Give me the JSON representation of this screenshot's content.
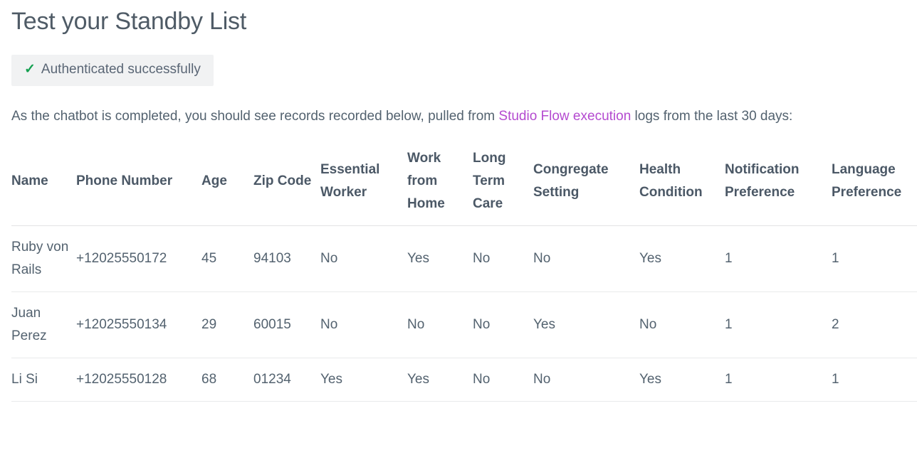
{
  "page": {
    "title": "Test your Standby List"
  },
  "auth_badge": {
    "icon": "check-icon",
    "label": "Authenticated successfully",
    "icon_glyph": "✓",
    "accent_color": "#14a051",
    "background_color": "#f1f2f3"
  },
  "description": {
    "before_link": "As the chatbot is completed, you should see records recorded below, pulled from ",
    "link_text": "Studio Flow execution",
    "after_link": " logs from the last 30 days:",
    "link_color": "#b44ad0"
  },
  "table": {
    "headers": [
      "Name",
      "Phone Number",
      "Age",
      "Zip Code",
      "Essential Worker",
      "Work from Home",
      "Long Term Care",
      "Congregate Setting",
      "Health Condition",
      "Notification Preference",
      "Language Preference"
    ],
    "rows": [
      {
        "name": "Ruby von Rails",
        "phone_number": "+12025550172",
        "age": "45",
        "zip_code": "94103",
        "essential_worker": "No",
        "work_from_home": "Yes",
        "long_term_care": "No",
        "congregate_setting": "No",
        "health_condition": "Yes",
        "notification_preference": "1",
        "language_preference": "1"
      },
      {
        "name": "Juan Perez",
        "phone_number": "+12025550134",
        "age": "29",
        "zip_code": "60015",
        "essential_worker": "No",
        "work_from_home": "No",
        "long_term_care": "No",
        "congregate_setting": "Yes",
        "health_condition": "No",
        "notification_preference": "1",
        "language_preference": "2"
      },
      {
        "name": "Li Si",
        "phone_number": "+12025550128",
        "age": "68",
        "zip_code": "01234",
        "essential_worker": "Yes",
        "work_from_home": "Yes",
        "long_term_care": "No",
        "congregate_setting": "No",
        "health_condition": "Yes",
        "notification_preference": "1",
        "language_preference": "1"
      }
    ]
  }
}
